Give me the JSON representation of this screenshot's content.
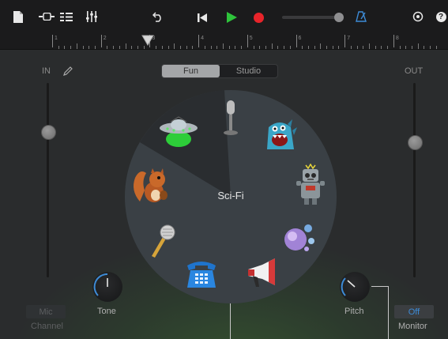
{
  "toolbar": {
    "icons": [
      "document-icon",
      "tracks-view-icon",
      "list-view-icon",
      "mixer-icon",
      "undo-icon",
      "rewind-icon",
      "play-icon",
      "record-icon",
      "master-volume-slider",
      "metronome-icon",
      "settings-icon",
      "help-icon"
    ],
    "help_label": "?"
  },
  "ruler": {
    "bars": [
      "1",
      "2",
      "3",
      "4",
      "5",
      "6",
      "7",
      "8"
    ]
  },
  "mode_tabs": {
    "fun": "Fun",
    "studio": "Studio",
    "selected": "Fun"
  },
  "input": {
    "label": "IN",
    "level": 0.79
  },
  "output": {
    "label": "OUT",
    "level": 0.72
  },
  "wheel": {
    "center_label": "Sci-Fi",
    "voices": [
      "microphone-icon",
      "monster-icon",
      "robot-icon",
      "bubbles-icon",
      "megaphone-icon",
      "telephone-icon",
      "handheld-mic-icon",
      "squirrel-icon",
      "ufo-icon"
    ],
    "selected_voice": "ufo-icon"
  },
  "tone": {
    "label": "Tone"
  },
  "pitch": {
    "label": "Pitch"
  },
  "mic_channel": {
    "button": "Mic",
    "label": "Channel"
  },
  "monitor": {
    "button": "Off",
    "label": "Monitor"
  },
  "colors": {
    "accent": "#3d8bd6",
    "play": "#2ec43b",
    "record": "#e8242a",
    "selected_wedge": "#2a2d30"
  }
}
